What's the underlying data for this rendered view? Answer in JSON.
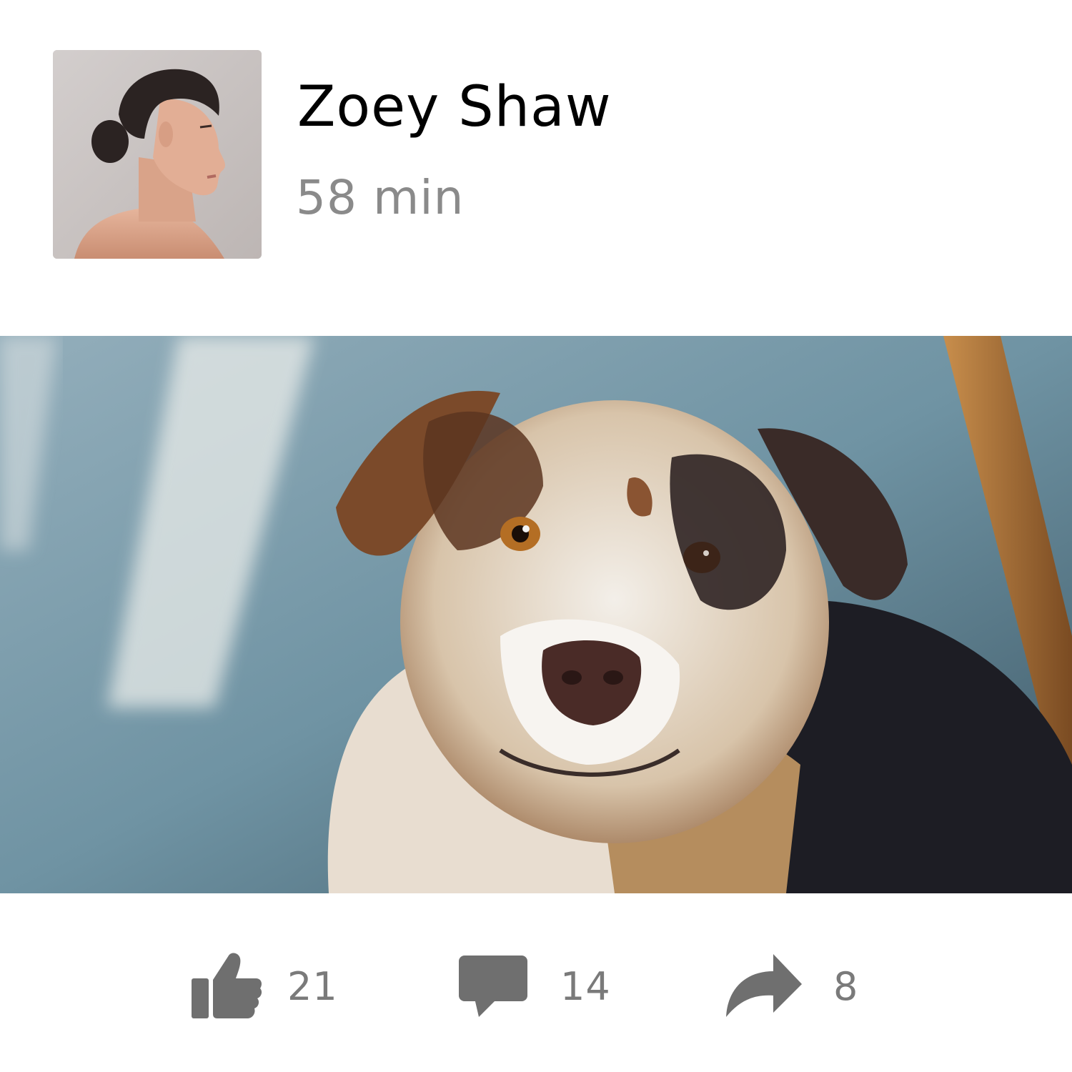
{
  "author": {
    "name": "Zoey Shaw",
    "avatar_icon": "avatar-photo"
  },
  "post": {
    "time_ago": "58 min",
    "photo_icon": "dog-photo"
  },
  "actions": {
    "like": {
      "icon": "thumbs-up-icon",
      "count": "21"
    },
    "comment": {
      "icon": "speech-bubble-icon",
      "count": "14"
    },
    "share": {
      "icon": "share-arrow-icon",
      "count": "8"
    }
  },
  "colors": {
    "icon_gray": "#6f6f6f",
    "count_gray": "#7a7a7a",
    "time_gray": "#8a8a8a",
    "name_black": "#000000"
  }
}
